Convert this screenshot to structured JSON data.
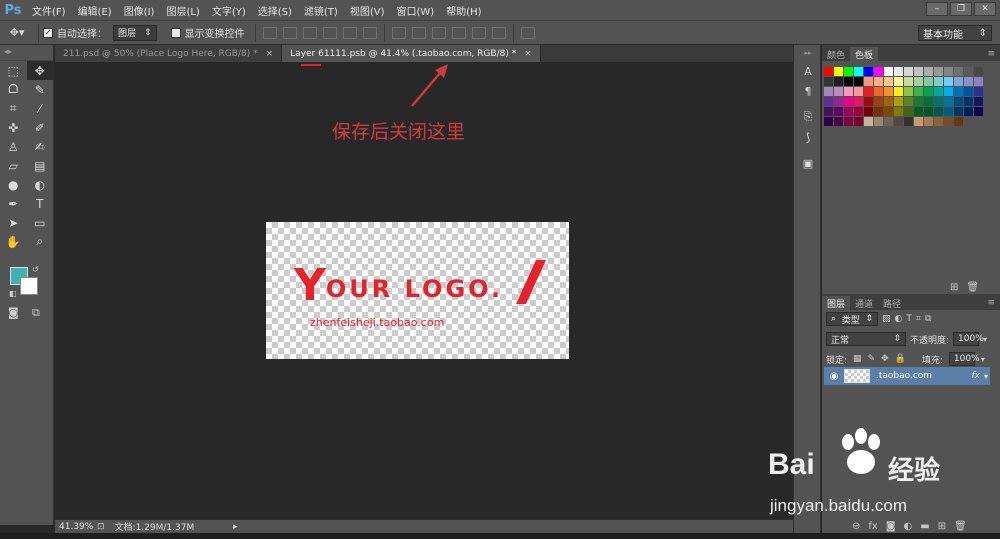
{
  "app": {
    "logo": "Ps"
  },
  "menu": [
    "文件(F)",
    "编辑(E)",
    "图像(I)",
    "图层(L)",
    "文字(Y)",
    "选择(S)",
    "滤镜(T)",
    "视图(V)",
    "窗口(W)",
    "帮助(H)"
  ],
  "options": {
    "auto_select_label": "自动选择：",
    "auto_select_value": "图层",
    "show_transform_label": "显示变换控件",
    "workspace": "基本功能"
  },
  "tabs": [
    {
      "label": "211.psd @ 50% (Place Logo Here, RGB/8) *",
      "close": "×"
    },
    {
      "label": "Layer 61111.psb @ 41.4% (.taobao.com, RGB/8) *",
      "close": "×"
    }
  ],
  "canvas": {
    "logo_big_letter": "Y",
    "logo_text": "OUR LOGO.",
    "logo_url": "zhenfeisheji.taobao.com",
    "annotation": "保存后关闭这里"
  },
  "status": {
    "zoom": "41.39%",
    "doc_info": "文档:1.29M/1.37M"
  },
  "color_panel": {
    "tabs": [
      "颜色",
      "色板"
    ]
  },
  "layers_panel": {
    "tabs": [
      "图层",
      "通道",
      "路径"
    ],
    "filter_kind": "类型",
    "blend_mode": "正常",
    "opacity_label": "不透明度:",
    "opacity_value": "100%",
    "lock_label": "锁定:",
    "fill_label": "填充:",
    "fill_value": "100%",
    "layer_name": ".taobao.com",
    "fx_label": "fx"
  },
  "watermark": {
    "brand": "Bai",
    "brand_cn": "经验",
    "url": "jingyan.baidu.com"
  },
  "colors": {
    "accent_red": "#e8202a",
    "annotation_red": "#d23a3a",
    "fg": "#3cb3b3",
    "bg": "#ffffff",
    "layer_selected": "#5b7fa8"
  },
  "swatch_colors": [
    "#ff0000",
    "#ffff00",
    "#00ff00",
    "#00ffff",
    "#0000ff",
    "#ff00ff",
    "#ffffff",
    "#ebebeb",
    "#d6d6d6",
    "#c2c2c2",
    "#adadad",
    "#999999",
    "#858585",
    "#707070",
    "#5c5c5c",
    "#474747",
    "#333333",
    "#1f1f1f",
    "#0a0a0a",
    "#000000",
    "#f7977a",
    "#f9ad81",
    "#fdc68a",
    "#fff79a",
    "#c4df9b",
    "#a2d39c",
    "#82ca9d",
    "#7bcdc8",
    "#6ecff6",
    "#7ea7d8",
    "#8493ca",
    "#8882be",
    "#a187be",
    "#bc8dbf",
    "#f49ac2",
    "#f6989d",
    "#ed1c24",
    "#f26522",
    "#f7941d",
    "#fff200",
    "#8dc73f",
    "#39b54a",
    "#00a651",
    "#00a99d",
    "#00aeef",
    "#0072bc",
    "#0054a6",
    "#2e3192",
    "#662d91",
    "#92278f",
    "#ec008c",
    "#ed145b",
    "#9e0b0f",
    "#a0410d",
    "#a36209",
    "#aba000",
    "#598527",
    "#1a7b30",
    "#007236",
    "#00746b",
    "#0076a3",
    "#004b80",
    "#003471",
    "#1b1464",
    "#440e62",
    "#630460",
    "#9e005d",
    "#9e0039",
    "#790000",
    "#7b2e00",
    "#7d4900",
    "#827b00",
    "#406618",
    "#005e20",
    "#005826",
    "#005952",
    "#005b7f",
    "#003663",
    "#002157",
    "#0d004c",
    "#32004b",
    "#4b0049",
    "#7b0046",
    "#7a0026",
    "#c7b299",
    "#998675",
    "#736357",
    "#534741",
    "#37302a",
    "#c69c6d",
    "#a67c52",
    "#8c6239",
    "#754c24",
    "#603913"
  ]
}
